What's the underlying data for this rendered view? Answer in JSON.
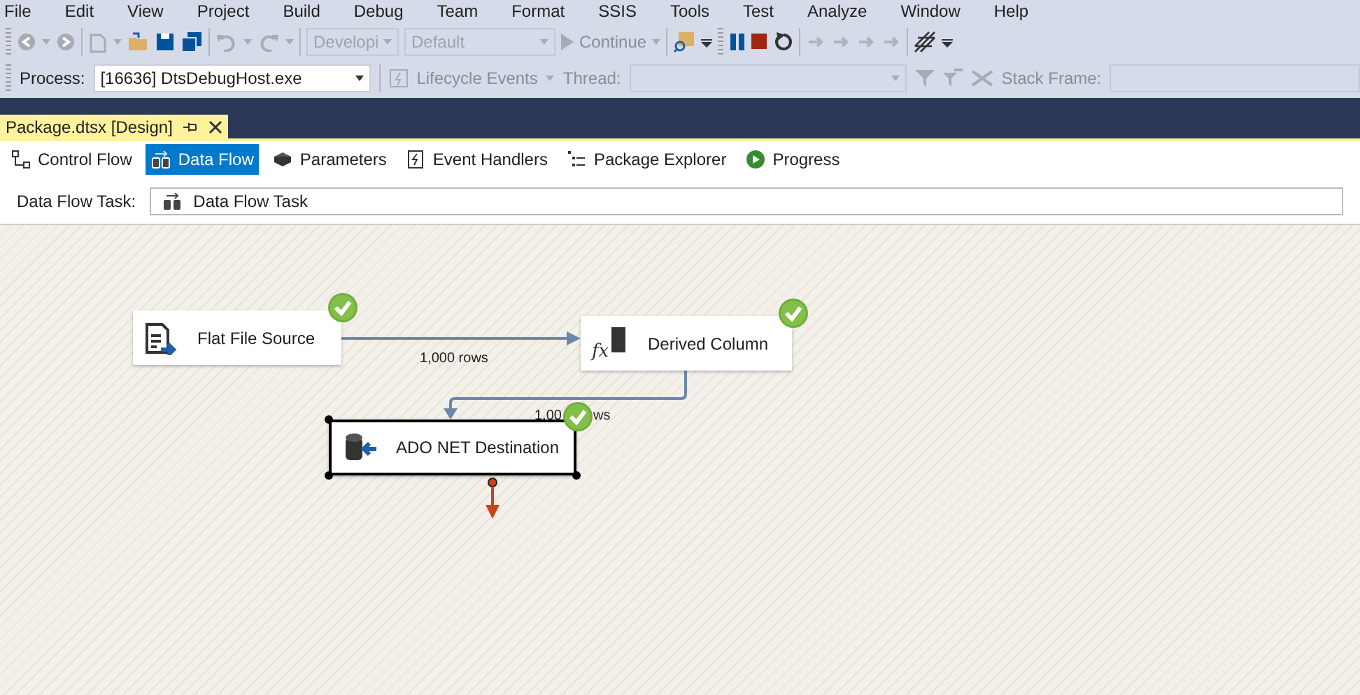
{
  "menu": [
    "File",
    "Edit",
    "View",
    "Project",
    "Build",
    "Debug",
    "Team",
    "Format",
    "SSIS",
    "Tools",
    "Test",
    "Analyze",
    "Window",
    "Help"
  ],
  "toolbar": {
    "config_dropdowns": [
      {
        "value": "Developi"
      },
      {
        "value": "Default"
      }
    ],
    "continue_label": "Continue"
  },
  "debug_location": {
    "process_label": "Process:",
    "process_value": "[16636] DtsDebugHost.exe",
    "lifecycle_label": "Lifecycle Events",
    "thread_label": "Thread:",
    "stack_frame_label": "Stack Frame:"
  },
  "document_tab": {
    "title": "Package.dtsx [Design]",
    "selected": true
  },
  "designer_tabs": [
    {
      "label": "Control Flow",
      "kind": "control",
      "selected": false
    },
    {
      "label": "Data Flow",
      "kind": "dataflow",
      "selected": true
    },
    {
      "label": "Parameters",
      "kind": "parameters",
      "selected": false
    },
    {
      "label": "Event Handlers",
      "kind": "events",
      "selected": false
    },
    {
      "label": "Package Explorer",
      "kind": "explorer",
      "selected": false
    },
    {
      "label": "Progress",
      "kind": "progress",
      "selected": false
    }
  ],
  "task_selector": {
    "label": "Data Flow Task:",
    "value": "Data Flow Task"
  },
  "components": [
    {
      "name": "Flat File Source",
      "kind": "source",
      "succeeded": true,
      "selected": false
    },
    {
      "name": "Derived Column",
      "kind": "derived",
      "icon_glyph": "fx",
      "succeeded": true,
      "selected": false
    },
    {
      "name": "ADO NET Destination",
      "kind": "destination",
      "succeeded": true,
      "selected": true
    }
  ],
  "paths": [
    {
      "label_pieces": [
        "1,000 rows"
      ]
    },
    {
      "label_pieces": [
        "1,00",
        "ws"
      ]
    }
  ]
}
